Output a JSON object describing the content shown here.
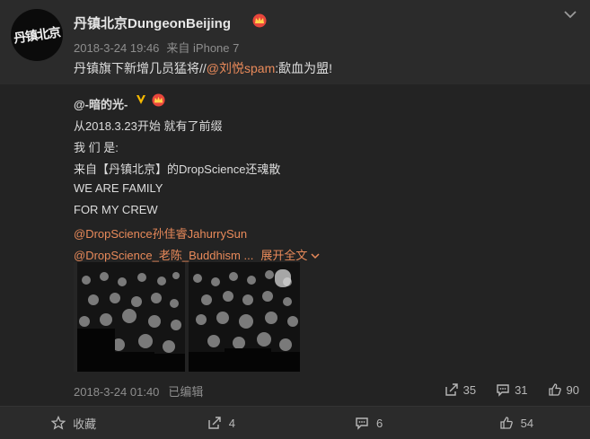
{
  "author": {
    "avatar_text": "丹镇北京",
    "name": "丹镇北京DungeonBeijing",
    "time": "2018-3-24 19:46",
    "source": "来自 iPhone 7"
  },
  "post": {
    "text_before": "丹镇旗下新增几员猛将//",
    "mention": "@刘悦spam",
    "text_after": ":歃血为盟!"
  },
  "repost": {
    "author": "@-暗的光-",
    "lines": [
      "从2018.3.23开始 就有了前缀",
      "我 们 是:",
      "来自【丹镇北京】的DropScience还魂散",
      "WE ARE FAMILY",
      "FOR MY CREW"
    ],
    "mention_1": "@DropScience孙佳睿JahurrySun",
    "mention_2": "@DropScience_老陈_Buddhism ...",
    "expand_label": "展开全文",
    "time": "2018-3-24 01:40",
    "edited": "已编辑",
    "reposts": "35",
    "comments": "31",
    "likes": "90"
  },
  "actions": {
    "favorite": "收藏",
    "share": "4",
    "comment": "6",
    "like": "54"
  },
  "colors": {
    "background": "#2b2b2b",
    "repost_background": "#232323",
    "accent": "#e98a5a",
    "crown": "#e8463c"
  }
}
